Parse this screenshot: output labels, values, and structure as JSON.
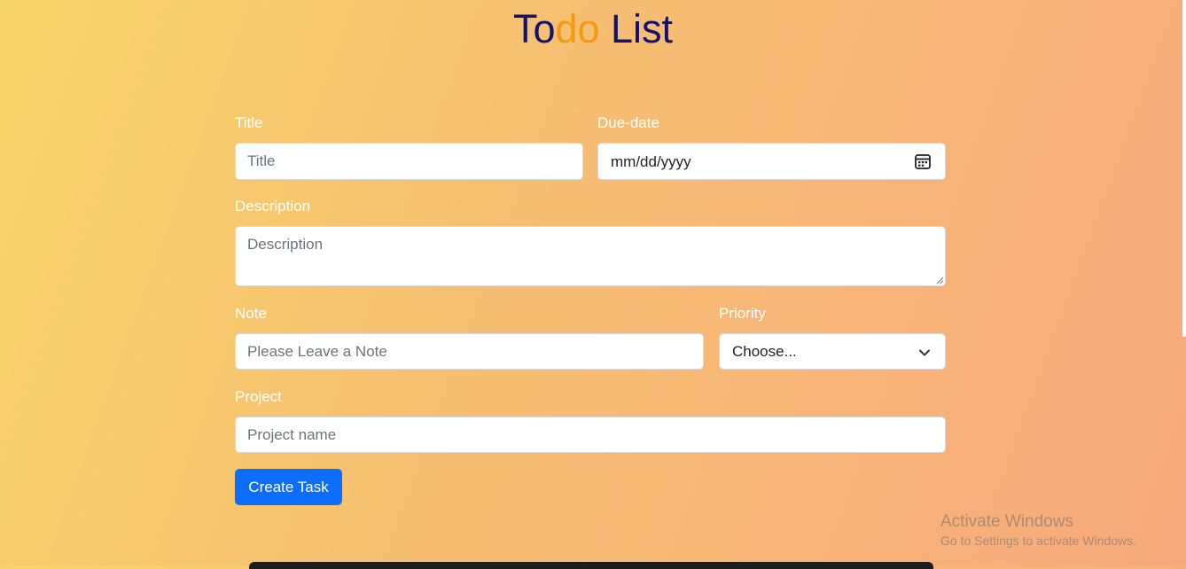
{
  "header": {
    "title_part1": "To",
    "title_part2": "do",
    "title_part3": " List"
  },
  "form": {
    "title": {
      "label": "Title",
      "placeholder": "Title"
    },
    "due_date": {
      "label": "Due-date",
      "value": "mm/dd/yyyy",
      "icon": "calendar-icon"
    },
    "description": {
      "label": "Description",
      "placeholder": "Description"
    },
    "note": {
      "label": "Note",
      "placeholder": "Please Leave a Note"
    },
    "priority": {
      "label": "Priority",
      "selected": "Choose...",
      "icon": "chevron-down-icon"
    },
    "project": {
      "label": "Project",
      "placeholder": "Project name"
    },
    "submit_label": "Create Task"
  },
  "watermark": {
    "line1": "Activate Windows",
    "line2": "Go to Settings to activate Windows."
  },
  "colors": {
    "title_navy": "#13136f",
    "title_orange": "#f59a10",
    "button": "#0d6efd"
  }
}
